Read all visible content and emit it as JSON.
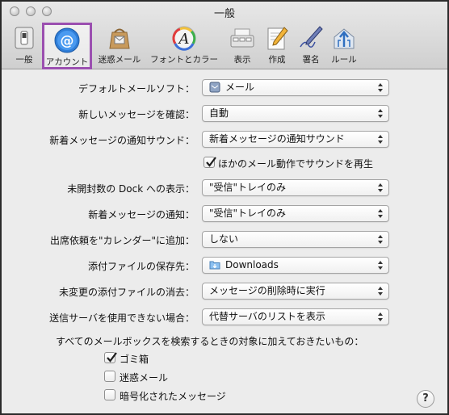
{
  "window": {
    "title": "一般"
  },
  "toolbar": {
    "items": [
      {
        "label": "一般",
        "icon": "general-switch-icon"
      },
      {
        "label": "アカウント",
        "icon": "at-sign-icon",
        "selected": true
      },
      {
        "label": "迷惑メール",
        "icon": "junk-mail-bag-icon"
      },
      {
        "label": "フォントとカラー",
        "icon": "font-color-icon"
      },
      {
        "label": "表示",
        "icon": "display-icon"
      },
      {
        "label": "作成",
        "icon": "compose-pencil-icon"
      },
      {
        "label": "署名",
        "icon": "signature-pen-icon"
      },
      {
        "label": "ルール",
        "icon": "rules-arrows-icon"
      }
    ]
  },
  "settings": {
    "default_mail": {
      "label": "デフォルトメールソフト：",
      "value": "メール"
    },
    "check_new": {
      "label": "新しいメッセージを確認：",
      "value": "自動"
    },
    "new_sound": {
      "label": "新着メッセージの通知サウンド：",
      "value": "新着メッセージの通知サウンド"
    },
    "play_sounds": {
      "label": "ほかのメール動作でサウンドを再生",
      "checked": true
    },
    "dock_unread": {
      "label": "未開封数の Dock への表示：",
      "value": "\"受信\"トレイのみ"
    },
    "new_notify": {
      "label": "新着メッセージの通知：",
      "value": "\"受信\"トレイのみ"
    },
    "calendar": {
      "label": "出席依頼を\"カレンダー\"に追加：",
      "value": "しない"
    },
    "download_folder": {
      "label": "添付ファイルの保存先：",
      "value": "Downloads"
    },
    "remove_attachments": {
      "label": "未変更の添付ファイルの消去：",
      "value": "メッセージの削除時に実行"
    },
    "outgoing_server": {
      "label": "送信サーバを使用できない場合：",
      "value": "代替サーバのリストを表示"
    }
  },
  "search_section": {
    "heading": "すべてのメールボックスを検索するときの対象に加えておきたいもの：",
    "options": [
      {
        "label": "ゴミ箱",
        "checked": true
      },
      {
        "label": "迷惑メール",
        "checked": false
      },
      {
        "label": "暗号化されたメッセージ",
        "checked": false
      }
    ]
  },
  "help": {
    "label": "?"
  }
}
